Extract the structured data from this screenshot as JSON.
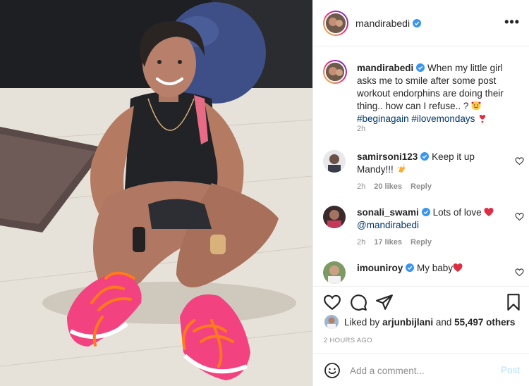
{
  "post": {
    "author": "mandirabedi",
    "verified": true,
    "more_label": "•••"
  },
  "caption": {
    "username": "mandirabedi",
    "text": "When my little girl asks me to smile after some post workout endorphins are doing their thing.. how can I refuse.. ?",
    "hashtags": "#beginagain #ilovemondays",
    "time": "2h"
  },
  "comments": [
    {
      "username": "samirsoni123",
      "verified": true,
      "text": "Keep it up Mandy!!!",
      "emoji": "clapping-hands",
      "time": "2h",
      "likes": "20 likes",
      "reply": "Reply"
    },
    {
      "username": "sonali_swami",
      "verified": true,
      "text": "Lots of love",
      "emoji": "red-heart",
      "mention": "@mandirabedi",
      "time": "2h",
      "likes": "17 likes",
      "reply": "Reply"
    },
    {
      "username": "imouniroy",
      "verified": true,
      "text": "My baby",
      "emoji": "red-heart"
    }
  ],
  "likes": {
    "prefix": "Liked by",
    "user": "arjunbijlani",
    "joiner": "and",
    "count": "55,497 others"
  },
  "timestamp": "2 HOURS AGO",
  "composer": {
    "placeholder": "Add a comment...",
    "post_label": "Post"
  },
  "icons": [
    "heart-icon",
    "comment-icon",
    "share-icon",
    "bookmark-icon",
    "emoji-icon",
    "verified-icon",
    "more-icon"
  ],
  "colors": {
    "link": "#00376b",
    "verified": "#3897f0",
    "muted": "#8e8e8e",
    "post_disabled": "#b2dffc",
    "shoe_pink": "#f2427f",
    "lace_orange": "#ff7a1a"
  }
}
